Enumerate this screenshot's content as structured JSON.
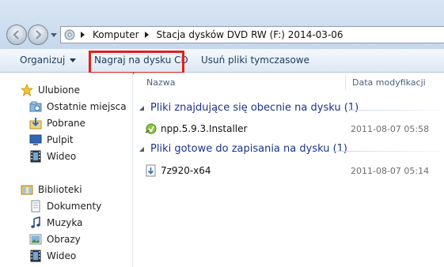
{
  "address": {
    "crumbs": [
      "Komputer",
      "Stacja dysków DVD RW (F:) 2014-03-06"
    ]
  },
  "toolbar": {
    "organize_label": "Organizuj",
    "burn_label": "Nagraj na dysku CD",
    "delete_temp_label": "Usuń pliki tymczasowe"
  },
  "navpane": {
    "favorites": {
      "label": "Ulubione",
      "items": [
        {
          "label": "Ostatnie miejsca",
          "icon": "recent-places-icon"
        },
        {
          "label": "Pobrane",
          "icon": "downloads-icon"
        },
        {
          "label": "Pulpit",
          "icon": "desktop-icon"
        },
        {
          "label": "Wideo",
          "icon": "video-icon"
        }
      ]
    },
    "libraries": {
      "label": "Biblioteki",
      "items": [
        {
          "label": "Dokumenty",
          "icon": "documents-icon"
        },
        {
          "label": "Muzyka",
          "icon": "music-icon"
        },
        {
          "label": "Obrazy",
          "icon": "pictures-icon"
        },
        {
          "label": "Wideo",
          "icon": "video-icon"
        }
      ]
    }
  },
  "content": {
    "columns": {
      "name": "Nazwa",
      "date": "Data modyfikacji"
    },
    "groups": [
      {
        "title": "Pliki znajdujące się obecnie na dysku (1)",
        "files": [
          {
            "name": "npp.5.9.3.Installer",
            "date": "2011-08-07 05:58",
            "icon": "installer-icon"
          }
        ]
      },
      {
        "title": "Pliki gotowe do zapisania na dysku (1)",
        "files": [
          {
            "name": "7z920-x64",
            "date": "2011-08-07 05:14",
            "icon": "pending-burn-file-icon"
          }
        ]
      }
    ]
  },
  "colors": {
    "highlight_frame": "#e3201b",
    "group_title": "#1e3287",
    "toolbar_text": "#1e395b"
  }
}
